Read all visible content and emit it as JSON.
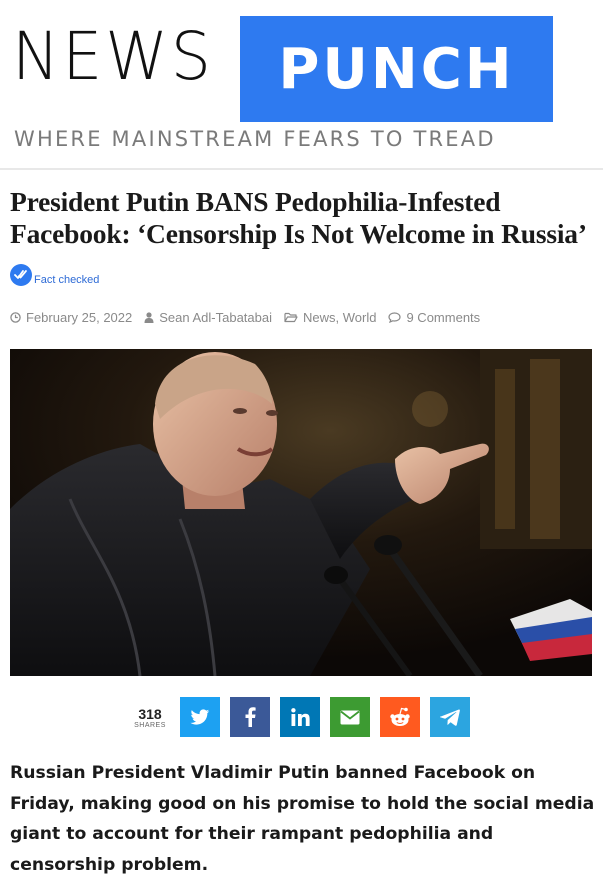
{
  "site": {
    "logo_left": "NEWS",
    "logo_right": "PUNCH",
    "tagline": "WHERE MAINSTREAM FEARS TO TREAD",
    "brand_color": "#2e7af0"
  },
  "article": {
    "title": "President Putin BANS Pedophilia-Infested Facebook: ‘Censorship Is Not Welcome in Russia’",
    "fact_check_label": "Fact checked",
    "date": "February 25, 2022",
    "author": "Sean Adl-Tabatabai",
    "category_1": "News",
    "category_sep": ", ",
    "category_2": "World",
    "comments": "9 Comments",
    "lead": "Russian President Vladimir Putin banned Facebook on Friday, making good on his promise to hold the social media giant to account for their rampant pedophilia and censorship problem."
  },
  "share": {
    "count": "318",
    "count_label": "SHARES",
    "buttons": [
      {
        "network": "twitter",
        "icon": "twitter-icon",
        "color": "#1da1f2"
      },
      {
        "network": "facebook",
        "icon": "facebook-icon",
        "color": "#3b5998"
      },
      {
        "network": "linkedin",
        "icon": "linkedin-icon",
        "color": "#0077b5"
      },
      {
        "network": "email",
        "icon": "email-icon",
        "color": "#3d9b32"
      },
      {
        "network": "reddit",
        "icon": "reddit-icon",
        "color": "#ff5a1f"
      },
      {
        "network": "telegram",
        "icon": "telegram-icon",
        "color": "#2ca5e0"
      }
    ]
  }
}
